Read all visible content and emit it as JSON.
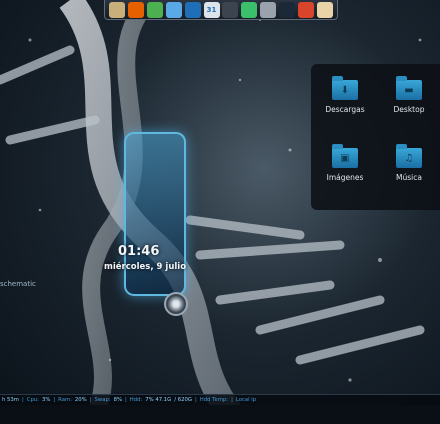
{
  "dock": {
    "items": [
      {
        "name": "file-manager-icon",
        "color": "#c9b07a"
      },
      {
        "name": "firefox-icon",
        "color": "#e66000"
      },
      {
        "name": "chrome-icon",
        "color": "#4caf50"
      },
      {
        "name": "weather-icon",
        "color": "#5aa9e6"
      },
      {
        "name": "terminal-icon",
        "color": "#1e6fb8"
      },
      {
        "name": "calendar-icon",
        "color": "#dde3ea",
        "text": "31"
      },
      {
        "name": "system-monitor-icon",
        "color": "#3b444f"
      },
      {
        "name": "ghost-icon",
        "color": "#3bbf6a"
      },
      {
        "name": "settings-gear-icon",
        "color": "#9aa3ad"
      },
      {
        "name": "steam-icon",
        "color": "#1b2838"
      },
      {
        "name": "chromium-icon",
        "color": "#d9442d"
      },
      {
        "name": "notes-icon",
        "color": "#e8d4a6"
      }
    ]
  },
  "desktop": {
    "items": [
      {
        "label": "Descargas",
        "icon": "download-icon",
        "glyph": "⬇"
      },
      {
        "label": "Desktop",
        "icon": "desktop-icon",
        "glyph": "▬"
      },
      {
        "label": "Imágenes",
        "icon": "image-icon",
        "glyph": "▣"
      },
      {
        "label": "Música",
        "icon": "music-icon",
        "glyph": "♫"
      }
    ]
  },
  "clock": {
    "time": "01:46",
    "date": "miércoles, 9 julio"
  },
  "widget": {
    "schematic_label": "schematic"
  },
  "status": {
    "uptime": "h 53m",
    "cpu_label": "Cpu:",
    "cpu_value": "3%",
    "ram_label": "Ram:",
    "ram_value": "20%",
    "swap_label": "Swap:",
    "swap_value": "8%",
    "hdd_label": "Hdd:",
    "hdd_value": "7% 47.1G",
    "hdd_total": "/ 620G",
    "hddtemp_label": "Hdd Temp:",
    "localip_label": "Local ip",
    "separator": "|"
  }
}
